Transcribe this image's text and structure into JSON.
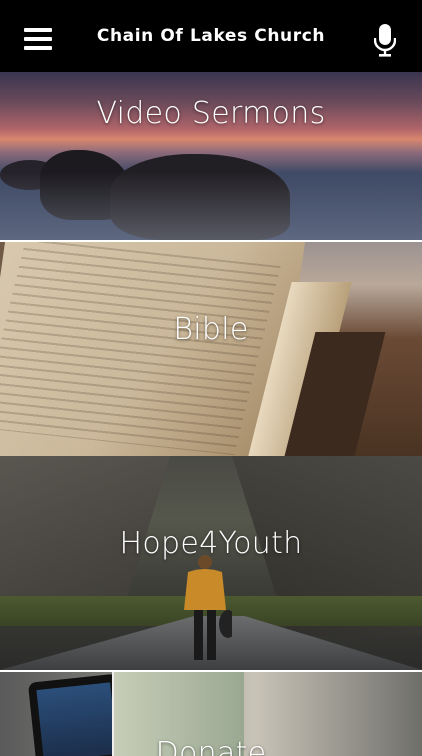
{
  "app": {
    "title": "Chain Of Lakes Church"
  },
  "header": {
    "menu_icon": "hamburger-menu-icon",
    "mic_icon": "microphone-icon"
  },
  "tiles": [
    {
      "label": "Video Sermons"
    },
    {
      "label": "Bible"
    },
    {
      "label": "Hope4Youth"
    },
    {
      "label": "Donate"
    }
  ],
  "colors": {
    "header_bg": "#000000",
    "header_text": "#ffffff",
    "tile_text": "#ffffff"
  }
}
